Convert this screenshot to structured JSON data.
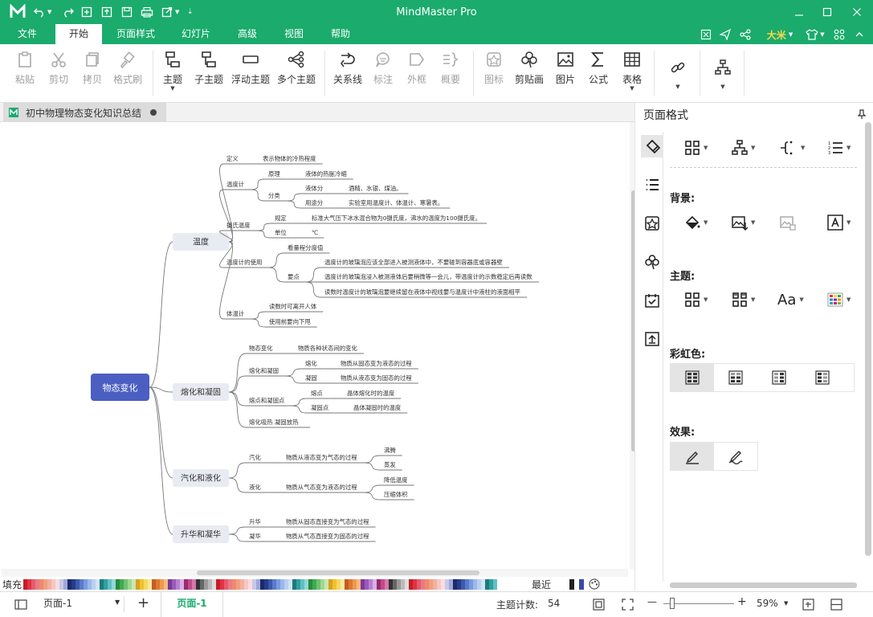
{
  "app": {
    "title": "MindMaster Pro",
    "user_name": "大米"
  },
  "colors": {
    "brand": "#1aab6d",
    "central": "#4a5fc1",
    "topic_bg": "#e9ebf3"
  },
  "menu_tabs": [
    "文件",
    "开始",
    "页面样式",
    "幻灯片",
    "高级",
    "视图",
    "帮助"
  ],
  "active_tab": "开始",
  "ribbon": {
    "paste": "粘贴",
    "cut": "剪切",
    "copy": "拷贝",
    "format_painter": "格式刷",
    "topic": "主题",
    "subtopic": "子主题",
    "floating_topic": "浮动主题",
    "multi_topic": "多个主题",
    "relationship": "关系线",
    "callout": "标注",
    "boundary": "外框",
    "summary": "概要",
    "icon": "图标",
    "clipart": "剪贴画",
    "picture": "图片",
    "formula": "公式",
    "table": "表格"
  },
  "document": {
    "tab_title": "初中物理物态变化知识总结"
  },
  "mindmap": {
    "central": "物态变化",
    "topics": [
      "温度",
      "熔化和凝固",
      "汽化和液化",
      "升华和凝华"
    ],
    "nodes": [
      "定义",
      "表示物体的冷热程度",
      "温度计",
      "原理",
      "液体的热胀冷缩",
      "分类",
      "液体分",
      "酒精、水银、煤油。",
      "用途分",
      "实验室用温度计、体温计、寒暑表。",
      "摄氏温度",
      "规定",
      "标准大气压下冰水混合物为0摄氏度，沸水的温度为100摄氏度。",
      "单位",
      "℃",
      "温度计的使用",
      "看量程分度值",
      "要点",
      "温度计的玻璃泡应该全部进入被测液体中，不要碰到容器底或容器壁",
      "温度计的玻璃泡浸入被测液体后要稍微等一会儿，带温度计的示数稳定后再读数",
      "读数时温度计的玻璃泡要继续留在液体中视线要与温度计中液柱的液面相平",
      "体温计",
      "读数时可离开人体",
      "使用前要向下甩",
      "物态变化",
      "物质各种状态间的变化",
      "熔化和凝固",
      "熔化",
      "物质从固态变为液态的过程",
      "凝固",
      "物质从液态变为固态的过程",
      "熔点和凝固点",
      "熔点",
      "晶体熔化时的温度",
      "凝固点",
      "晶体凝固时的温度",
      "熔化吸热  凝固放热",
      "汽化",
      "物质从液态变为气态的过程",
      "沸腾",
      "蒸发",
      "液化",
      "物质从气态变为液态的过程",
      "降低温度",
      "压缩体积",
      "升华",
      "物质从固态直接变为气态的过程",
      "凝华",
      "物质从气态直接变为固态的过程"
    ]
  },
  "palette": {
    "fill_label": "填充",
    "recent_label": "最近"
  },
  "status": {
    "page_dropdown": "页面-1",
    "add": "+",
    "page_tab": "页面-1",
    "topic_count_label": "主题计数:",
    "topic_count": "54",
    "zoom_minus": "—",
    "zoom_plus": "+",
    "zoom": "59%"
  },
  "right_panel": {
    "title": "页面格式",
    "background": "背景:",
    "theme": "主题:",
    "rainbow": "彩虹色:",
    "effect": "效果:",
    "font_glyph": "Aa"
  }
}
